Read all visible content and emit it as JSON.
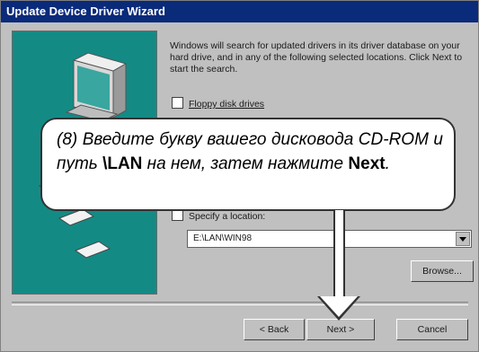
{
  "window": {
    "title": "Update Device Driver Wizard"
  },
  "content": {
    "intro": "Windows will search for updated drivers in its driver database on your hard drive, and in any of the following selected locations. Click Next to start the search.",
    "checkbox_floppy": "Floppy disk drives",
    "checkbox_specify": "Specify a location:",
    "location_value": "E:\\LAN\\WIN98",
    "browse_label": "Browse..."
  },
  "buttons": {
    "back": "< Back",
    "next": "Next >",
    "cancel": "Cancel"
  },
  "callout": {
    "prefix": "(8) Введите букву вашего дисковода CD-ROM и путь ",
    "path": "\\LAN",
    "middle": " на нем, затем нажмите ",
    "next_word": "Next",
    "suffix": "."
  },
  "colors": {
    "titlebar": "#0a2a7a",
    "dialog": "#c0c0c0",
    "wizard_panel": "#148a85"
  }
}
